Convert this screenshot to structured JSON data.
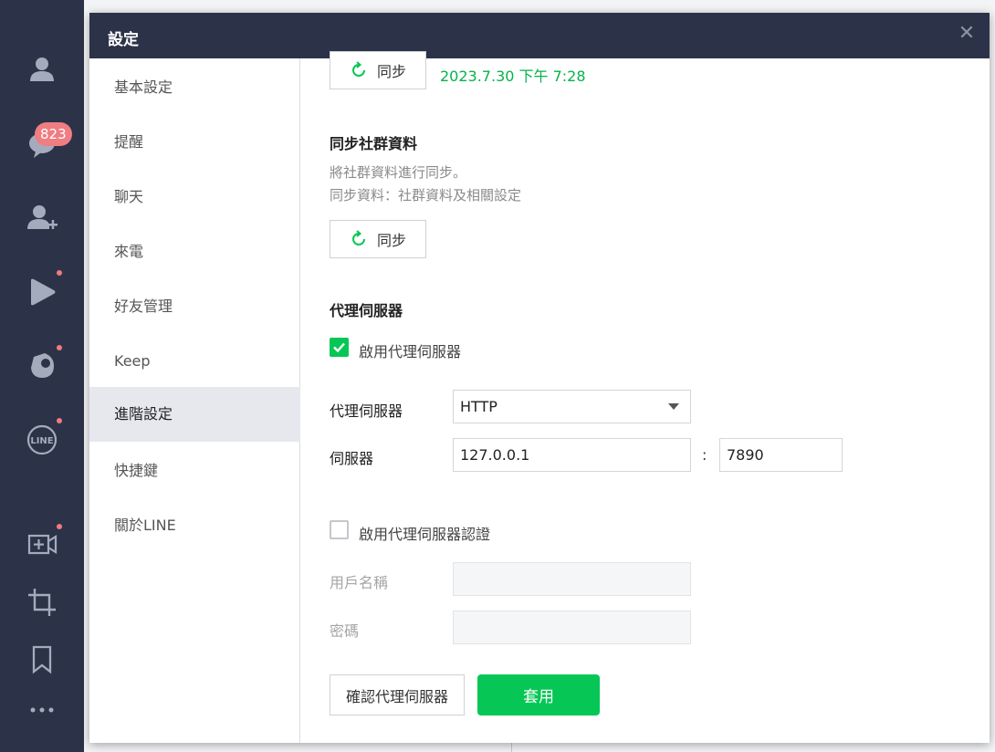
{
  "rail": {
    "chat_badge": "823",
    "items": [
      {
        "icon": "profile-icon"
      },
      {
        "icon": "chat-icon"
      },
      {
        "icon": "add-friend-icon"
      },
      {
        "icon": "play-icon"
      },
      {
        "icon": "voom-icon"
      },
      {
        "icon": "line-icon",
        "text": "LINE"
      },
      {
        "icon": "video-add-icon"
      },
      {
        "icon": "crop-icon"
      },
      {
        "icon": "bookmark-icon"
      },
      {
        "icon": "more-icon"
      }
    ]
  },
  "dialog": {
    "title": "設定",
    "close": "✕"
  },
  "nav": {
    "items": [
      {
        "label": "基本設定"
      },
      {
        "label": "提醒"
      },
      {
        "label": "聊天"
      },
      {
        "label": "來電"
      },
      {
        "label": "好友管理"
      },
      {
        "label": "Keep"
      },
      {
        "label": "進階設定",
        "active": true
      },
      {
        "label": "快捷鍵"
      },
      {
        "label": "關於LINE"
      }
    ]
  },
  "content": {
    "sync_top": {
      "label": "同步",
      "time": "2023.7.30 下午 7:28"
    },
    "community": {
      "title": "同步社群資料",
      "desc1": "將社群資料進行同步。",
      "desc2": "同步資料：社群資料及相關設定",
      "sync_label": "同步"
    },
    "proxy": {
      "title": "代理伺服器",
      "enable_label": "啟用代理伺服器",
      "enable_checked": true,
      "type_label": "代理伺服器",
      "type_value": "HTTP",
      "server_label": "伺服器",
      "host": "127.0.0.1",
      "colon": ":",
      "port": "7890",
      "auth_label": "啟用代理伺服器認證",
      "auth_checked": false,
      "username_label": "用戶名稱",
      "username_value": "",
      "password_label": "密碼",
      "password_value": "",
      "confirm_button": "確認代理伺服器",
      "apply_button": "套用"
    }
  },
  "colors": {
    "rail_bg": "#2c3348",
    "accent_green": "#06c755",
    "sync_time_green": "#06b24a",
    "badge_red": "#ef7d82"
  }
}
